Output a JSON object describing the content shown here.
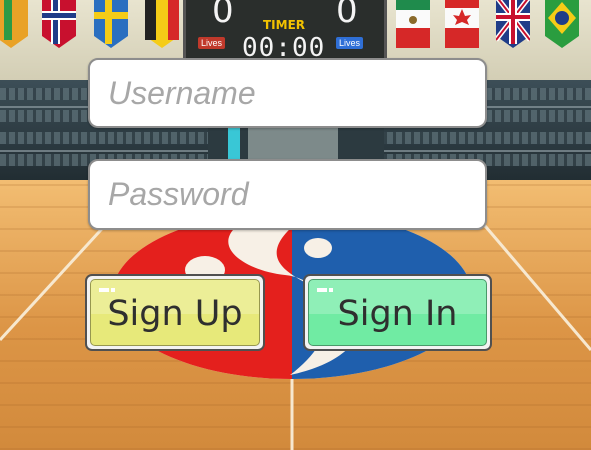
{
  "scoreboard": {
    "home_score": "0",
    "away_score": "0",
    "timer_label": "TIMER",
    "time": "00:00",
    "home_lives_label": "Lives",
    "away_lives_label": "Lives"
  },
  "login_form": {
    "username_placeholder": "Username",
    "username_value": "",
    "password_placeholder": "Password",
    "password_value": "",
    "sign_up_label": "Sign Up",
    "sign_in_label": "Sign In"
  },
  "colors": {
    "sign_up_button": "#e7e97a",
    "sign_in_button": "#70eba3",
    "court_red": "#e4201d",
    "court_blue": "#1f5fad"
  },
  "decor": {
    "pennants_left": [
      "pennant-icon",
      "norway-flag-icon",
      "sweden-flag-icon",
      "belgium-flag-icon"
    ],
    "pennants_right": [
      "mexico-flag-icon",
      "canada-flag-icon",
      "uk-flag-icon",
      "brazil-flag-icon"
    ]
  }
}
